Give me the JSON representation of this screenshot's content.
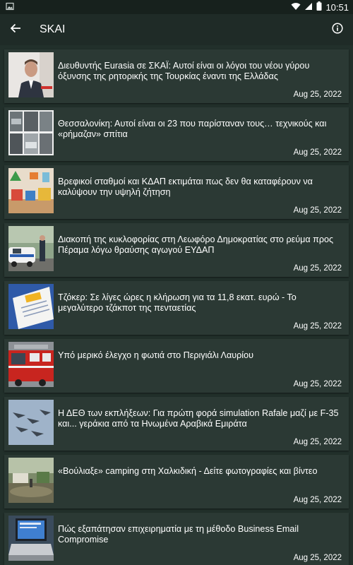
{
  "status_bar": {
    "time": "10:51",
    "icons": [
      "image-notification-icon",
      "wifi-icon",
      "signal-icon",
      "battery-icon"
    ]
  },
  "app_bar": {
    "title": "SKAI",
    "back_icon": "arrow-left-icon",
    "info_icon": "info-icon"
  },
  "articles": [
    {
      "title": "Διευθυντής Eurasia σε ΣΚΑΪ: Αυτοί είναι οι λόγοι του νέου γύρου όξυνσης της ρητορικής της Τουρκίας έναντι της Ελλάδας",
      "date": "Aug 25, 2022"
    },
    {
      "title": "Θεσσαλονίκη: Αυτοί είναι οι 23 που παρίσταναν τους… τεχνικούς και «ρήμαζαν» σπίτια",
      "date": "Aug 25, 2022"
    },
    {
      "title": "Βρεφικοί σταθμοί και ΚΔΑΠ εκτιμάται πως δεν θα καταφέρουν να καλύψουν την υψηλή ζήτηση",
      "date": "Aug 25, 2022"
    },
    {
      "title": "Διακοπή της κυκλοφορίας στη Λεωφόρο Δημοκρατίας στο ρεύμα προς Πέραμα λόγω θραύσης αγωγού ΕΥΔΑΠ",
      "date": "Aug 25, 2022"
    },
    {
      "title": "Τζόκερ: Σε λίγες ώρες η κλήρωση για τα 11,8 εκατ. ευρώ - Το μεγαλύτερο τζάκποτ της πενταετίας",
      "date": "Aug 25, 2022"
    },
    {
      "title": "Υπό μερικό έλεγχο η φωτιά στο Περιγιάλι Λαυρίου",
      "date": "Aug 25, 2022"
    },
    {
      "title": "Η ΔΕΘ των εκπλήξεων: Για πρώτη φορά simulation Rafale μαζί με F-35 και... γεράκια από τα Ηνωμένα Αραβικά Εμιράτα",
      "date": "Aug 25, 2022"
    },
    {
      "title": "«Βούλιαξε» camping στη Χαλκιδική - Δείτε φωτογραφίες και βίντεο",
      "date": "Aug 25, 2022"
    },
    {
      "title": "Πώς εξαπάτησαν επιχειρηματία με τη μέθοδο Business Email Compromise",
      "date": "Aug 25, 2022"
    }
  ]
}
